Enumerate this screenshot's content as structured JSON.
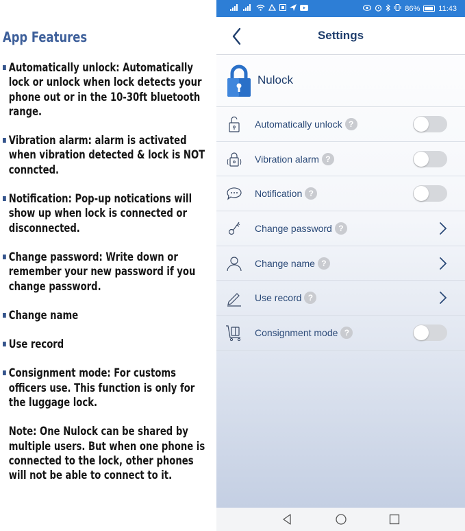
{
  "features": {
    "title": "App Features",
    "items": [
      "Automatically unlock: Automatically lock or unlock when lock detects your phone out or in the 10-30ft bluetooth range.",
      "Vibration alarm: alarm is activated when vibration detected & lock is NOT conncted.",
      "Notification: Pop-up notications will show up when lock is connected or disconnected.",
      "Change password: Write down or remember your new password if you change password.",
      "Change name",
      "Use record",
      "Consignment mode: For customs officers use. This function is only for the luggage lock."
    ],
    "note": "Note: One Nulock can be shared by multiple users. But when one phone is connected to the lock, other phones will not be able to connect to it."
  },
  "status_bar": {
    "battery": "86%",
    "time": "11:43",
    "icons": [
      "signal-icon",
      "signal-icon",
      "wifi-icon",
      "app-icon",
      "app-icon",
      "send-icon",
      "youtube-icon",
      "eye-icon",
      "alarm-icon",
      "bluetooth-icon",
      "vibrate-icon",
      "battery-icon"
    ]
  },
  "header": {
    "title": "Settings",
    "back_icon": "chevron-left-icon"
  },
  "device": {
    "name": "Nulock",
    "icon": "padlock-icon"
  },
  "settings": [
    {
      "label": "Automatically unlock",
      "icon": "unlock-icon",
      "control": "toggle",
      "on": false
    },
    {
      "label": "Vibration alarm",
      "icon": "alarm-lock-icon",
      "control": "toggle",
      "on": false
    },
    {
      "label": "Notification",
      "icon": "chat-bubble-icon",
      "control": "toggle",
      "on": false
    },
    {
      "label": "Change password",
      "icon": "key-icon",
      "control": "chevron"
    },
    {
      "label": "Change name",
      "icon": "person-icon",
      "control": "chevron"
    },
    {
      "label": "Use record",
      "icon": "pencil-icon",
      "control": "chevron"
    },
    {
      "label": "Consignment mode",
      "icon": "luggage-cart-icon",
      "control": "toggle",
      "on": false
    }
  ],
  "help_glyph": "?",
  "colors": {
    "status_bar": "#2d7ed6",
    "title_text": "#1f3e6d",
    "label_text": "#2b4a78",
    "feature_title": "#3d5f9a",
    "bullet": "#34548c",
    "toggle_off": "#d6d8dc",
    "help_badge": "#c9cbd0"
  }
}
